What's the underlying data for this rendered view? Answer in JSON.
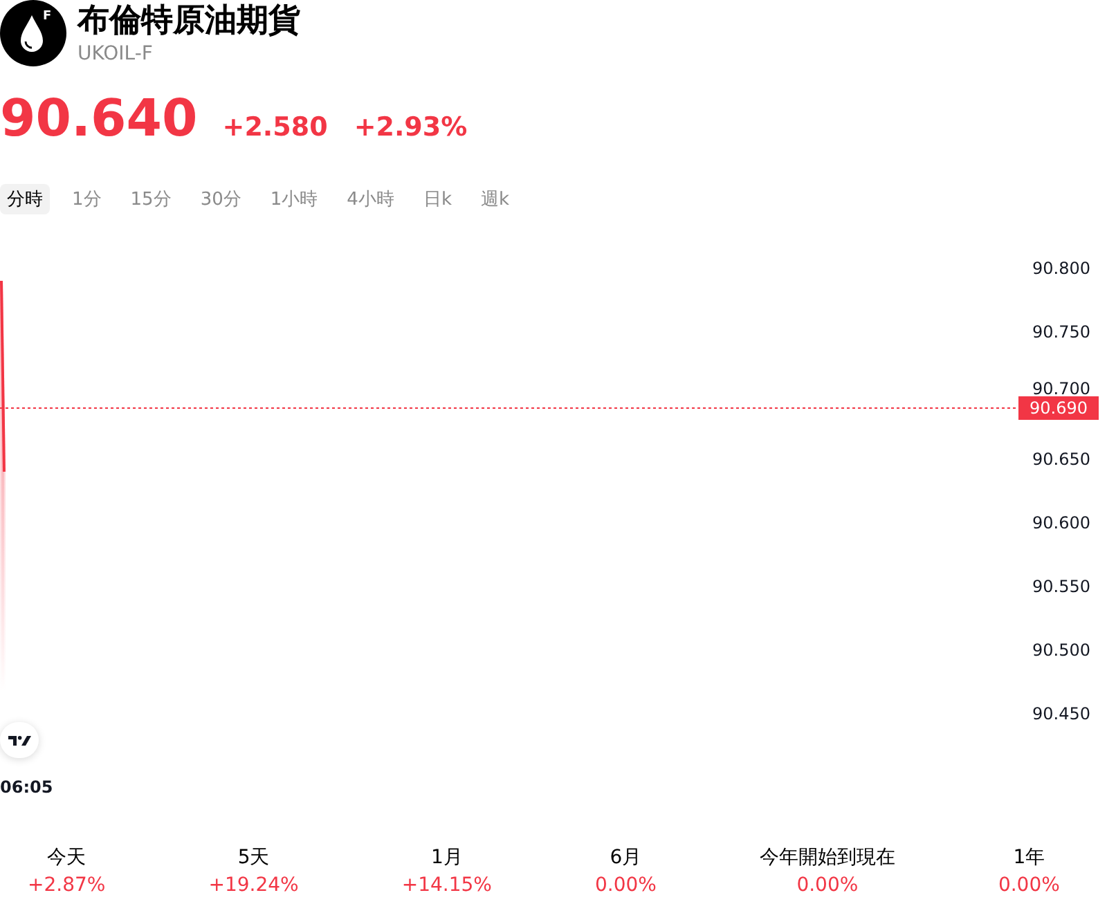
{
  "header": {
    "logo_letter": "F",
    "title": "布倫特原油期貨",
    "symbol": "UKOIL-F"
  },
  "quote": {
    "price": "90.640",
    "change": "+2.580",
    "change_percent": "+2.93%"
  },
  "intervals": [
    {
      "label": "分時",
      "selected": true
    },
    {
      "label": "1分",
      "selected": false
    },
    {
      "label": "15分",
      "selected": false
    },
    {
      "label": "30分",
      "selected": false
    },
    {
      "label": "1小時",
      "selected": false
    },
    {
      "label": "4小時",
      "selected": false
    },
    {
      "label": "日k",
      "selected": false
    },
    {
      "label": "週k",
      "selected": false
    }
  ],
  "chart": {
    "price_scale": [
      "90.800",
      "90.750",
      "90.700",
      "90.650",
      "90.600",
      "90.550",
      "90.500",
      "90.450"
    ],
    "price_tag": "90.690",
    "time_label": "06:05"
  },
  "performance": [
    {
      "period": "今天",
      "change": "+2.87%"
    },
    {
      "period": "5天",
      "change": "+19.24%"
    },
    {
      "period": "1月",
      "change": "+14.15%"
    },
    {
      "period": "6月",
      "change": "0.00%"
    },
    {
      "period": "今年開始到現在",
      "change": "0.00%"
    },
    {
      "period": "1年",
      "change": "0.00%"
    }
  ]
}
